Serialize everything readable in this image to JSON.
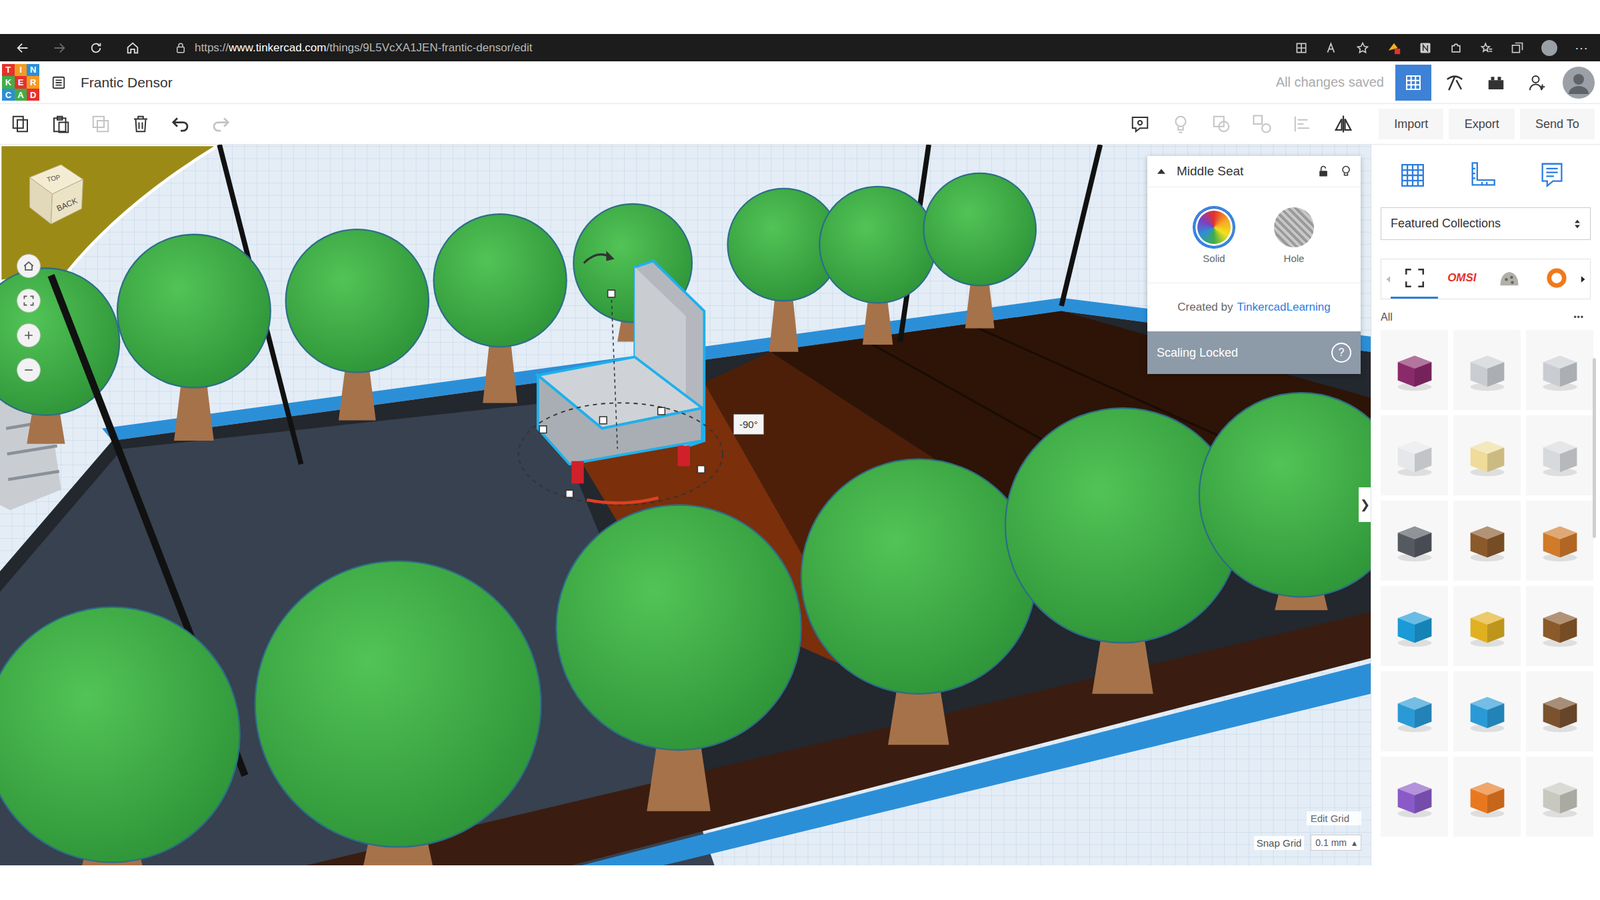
{
  "browser": {
    "url_scheme": "https://",
    "url_host": "www.tinkercad.com",
    "url_path": "/things/9L5VcXA1JEN-frantic-densor/edit",
    "nav": [
      {
        "kind": "back",
        "disabled": false
      },
      {
        "kind": "forward",
        "disabled": true
      },
      {
        "kind": "reload",
        "disabled": false
      },
      {
        "kind": "home",
        "disabled": false
      }
    ],
    "menu": "⋯"
  },
  "app": {
    "logo": [
      "T",
      "I",
      "N",
      "K",
      "E",
      "R",
      "C",
      "A",
      "D"
    ],
    "title": "Frantic Densor",
    "save_status": "All changes saved",
    "views": [
      {
        "kind": "design",
        "selected": true
      },
      {
        "kind": "blocks",
        "selected": false
      },
      {
        "kind": "bricks",
        "selected": false
      }
    ]
  },
  "toolbar": {
    "edit_tools": [
      {
        "kind": "copy",
        "disabled": false
      },
      {
        "kind": "paste",
        "disabled": false
      },
      {
        "kind": "duplicate",
        "disabled": true
      },
      {
        "kind": "delete",
        "disabled": false
      },
      {
        "kind": "undo",
        "disabled": false
      },
      {
        "kind": "redo",
        "disabled": true
      }
    ],
    "shape_tools": [
      {
        "kind": "note",
        "disabled": false
      },
      {
        "kind": "light",
        "disabled": true
      },
      {
        "kind": "group",
        "disabled": true
      },
      {
        "kind": "ungroup",
        "disabled": true
      },
      {
        "kind": "align",
        "disabled": true
      },
      {
        "kind": "mirror",
        "disabled": false
      }
    ],
    "actions": [
      "Import",
      "Export",
      "Send To"
    ]
  },
  "view_cube": {
    "top": "TOP",
    "back": "BACK"
  },
  "view_controls": [
    {
      "kind": "home"
    },
    {
      "kind": "fit"
    },
    {
      "kind": "zoom-in"
    },
    {
      "kind": "zoom-out"
    }
  ],
  "inspector": {
    "title": "Middle Seat",
    "modes": [
      {
        "label": "Solid",
        "selected": true
      },
      {
        "label": "Hole",
        "selected": false
      }
    ],
    "credit_label": "Created by",
    "credit_author": "TinkercadLearning",
    "scaling": "Scaling Locked",
    "help": "?"
  },
  "rotation_readout": "-90°",
  "grid_settings": {
    "edit": "Edit Grid",
    "snap_label": "Snap Grid",
    "snap_value": "0.1 mm",
    "snap_arrow": "▴"
  },
  "panel": {
    "tools": [
      {
        "kind": "shapes"
      },
      {
        "kind": "ruler"
      },
      {
        "kind": "notes"
      }
    ],
    "library": "Featured Collections",
    "collections": [
      {
        "kind": "all",
        "label": "",
        "selected": true
      },
      {
        "kind": "omsi",
        "label": "OMSI",
        "selected": false
      },
      {
        "kind": "rock",
        "label": "",
        "selected": false
      },
      {
        "kind": "ring",
        "label": "",
        "selected": false
      }
    ],
    "prev_disabled": true,
    "filter": "All",
    "more": "•••",
    "collapse": "❯",
    "parts": [
      {
        "color": "#8a2a6a"
      },
      {
        "color": "#c9cdd2"
      },
      {
        "color": "#c9cdd2"
      },
      {
        "color": "#e6e7ea"
      },
      {
        "color": "#efdc9a"
      },
      {
        "color": "#d7d9dc"
      },
      {
        "color": "#555a61"
      },
      {
        "color": "#8b5a2b"
      },
      {
        "color": "#d07a2a"
      },
      {
        "color": "#1a9ad6"
      },
      {
        "color": "#e0b020"
      },
      {
        "color": "#8b5a2b"
      },
      {
        "color": "#2a9ad6"
      },
      {
        "color": "#2a9ad6"
      },
      {
        "color": "#7a5230"
      },
      {
        "color": "#8a5ac8"
      },
      {
        "color": "#e87820"
      },
      {
        "color": "#c8c8c0"
      }
    ]
  }
}
